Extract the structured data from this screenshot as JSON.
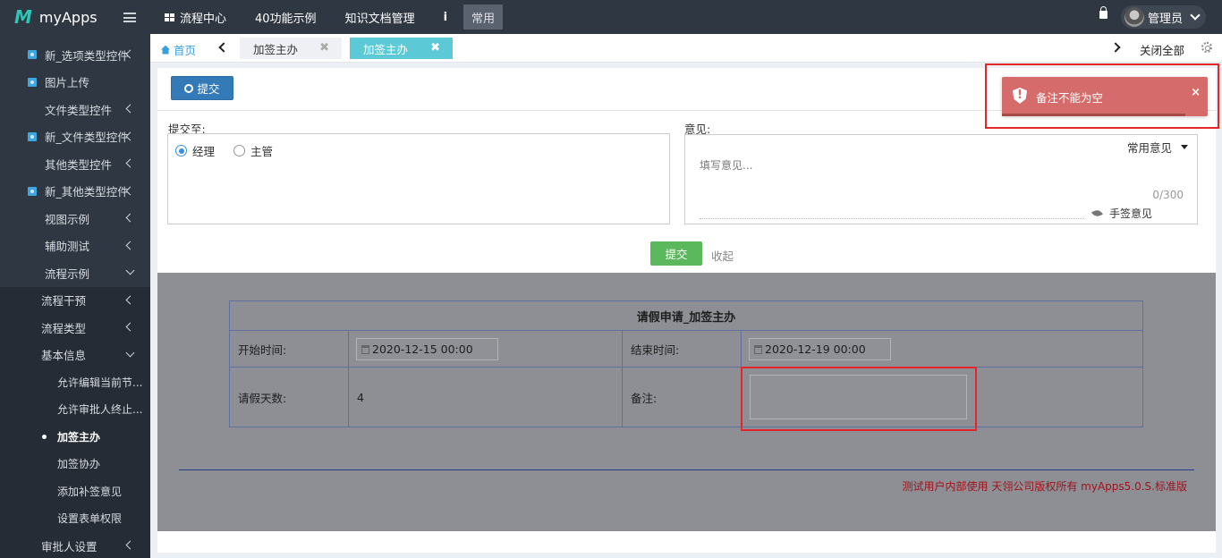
{
  "app": {
    "logo": "M",
    "name": "myApps"
  },
  "topnav": {
    "items": [
      "流程中心",
      "40功能示例",
      "知识文档管理"
    ],
    "info": "i",
    "common": "常用",
    "user": "管理员"
  },
  "sidebar": {
    "items": [
      {
        "label": "新_选项类型控件",
        "type": "icon"
      },
      {
        "label": "图片上传",
        "type": "icon"
      },
      {
        "label": "文件类型控件",
        "type": "l2"
      },
      {
        "label": "新_文件类型控件",
        "type": "icon"
      },
      {
        "label": "其他类型控件",
        "type": "l2"
      },
      {
        "label": "新_其他类型控件",
        "type": "icon"
      },
      {
        "label": "视图示例",
        "type": "l2"
      },
      {
        "label": "辅助测试",
        "type": "l2"
      },
      {
        "label": "流程示例",
        "type": "l2"
      },
      {
        "label": "流程干预",
        "type": "l1"
      },
      {
        "label": "流程类型",
        "type": "l1"
      },
      {
        "label": "基本信息",
        "type": "l1"
      },
      {
        "label": "允许编辑当前节...",
        "type": "l3"
      },
      {
        "label": "允许审批人终止...",
        "type": "l3"
      },
      {
        "label": "加签主办",
        "type": "l3"
      },
      {
        "label": "加签协办",
        "type": "l3"
      },
      {
        "label": "添加补签意见",
        "type": "l3"
      },
      {
        "label": "设置表单权限",
        "type": "l3"
      },
      {
        "label": "审批人设置",
        "type": "l1"
      }
    ]
  },
  "tabs": {
    "home": "首页",
    "items": [
      "加签主办",
      "加签主办"
    ],
    "close_all": "关闭全部"
  },
  "toolbar": {
    "submit": "提交"
  },
  "sendto": {
    "label": "提交至:",
    "options": [
      "经理",
      "主管"
    ]
  },
  "opinion": {
    "label": "意见:",
    "common": "常用意见",
    "placeholder": "填写意见...",
    "count": "0/300",
    "sign": "手签意见"
  },
  "actions": {
    "submit": "提交",
    "collapse": "收起"
  },
  "form": {
    "title": "请假申请_加签主办",
    "start_label": "开始时间:",
    "start_value": "2020-12-15 00:00",
    "end_label": "结束时间:",
    "end_value": "2020-12-19 00:00",
    "days_label": "请假天数:",
    "days_value": "4",
    "remark_label": "备注:",
    "remark_value": ""
  },
  "copyright": "测试用户内部使用 天翎公司版权所有 myApps5.0.S.标准版",
  "toast": {
    "message": "备注不能为空",
    "close": "×"
  },
  "colors": {
    "sidebar": "#2f3742",
    "accent": "#5bc9d6",
    "primary": "#337ab7",
    "success": "#5cb85c",
    "toast": "#d56b6a",
    "highlight": "#e3262a"
  }
}
